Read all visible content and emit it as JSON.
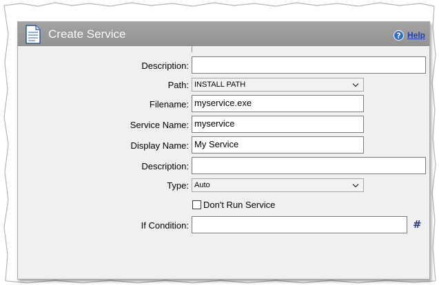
{
  "window": {
    "title": "Create Service",
    "help_label": "Help"
  },
  "form": {
    "description1": {
      "label": "Description:",
      "value": ""
    },
    "path": {
      "label": "Path:",
      "value": "INSTALL PATH"
    },
    "filename": {
      "label": "Filename:",
      "value": "myservice.exe"
    },
    "service_name": {
      "label": "Service Name:",
      "value": "myservice"
    },
    "display_name": {
      "label": "Display Name:",
      "value": "My Service"
    },
    "description2": {
      "label": "Description:",
      "value": ""
    },
    "type": {
      "label": "Type:",
      "value": "Auto"
    },
    "dont_run": {
      "label": "Don't Run Service",
      "checked": false
    },
    "if_condition": {
      "label": "If Condition:",
      "value": "",
      "hash_label": "#"
    }
  },
  "colors": {
    "titlebar": "#9b9b9b",
    "dialog_bg": "#f0f0f0",
    "help_link": "#1b3fbf",
    "hash": "#2b3a8f"
  },
  "icons": {
    "title": "document-icon",
    "help": "question-circle-icon",
    "dropdown": "chevron-down-icon"
  }
}
